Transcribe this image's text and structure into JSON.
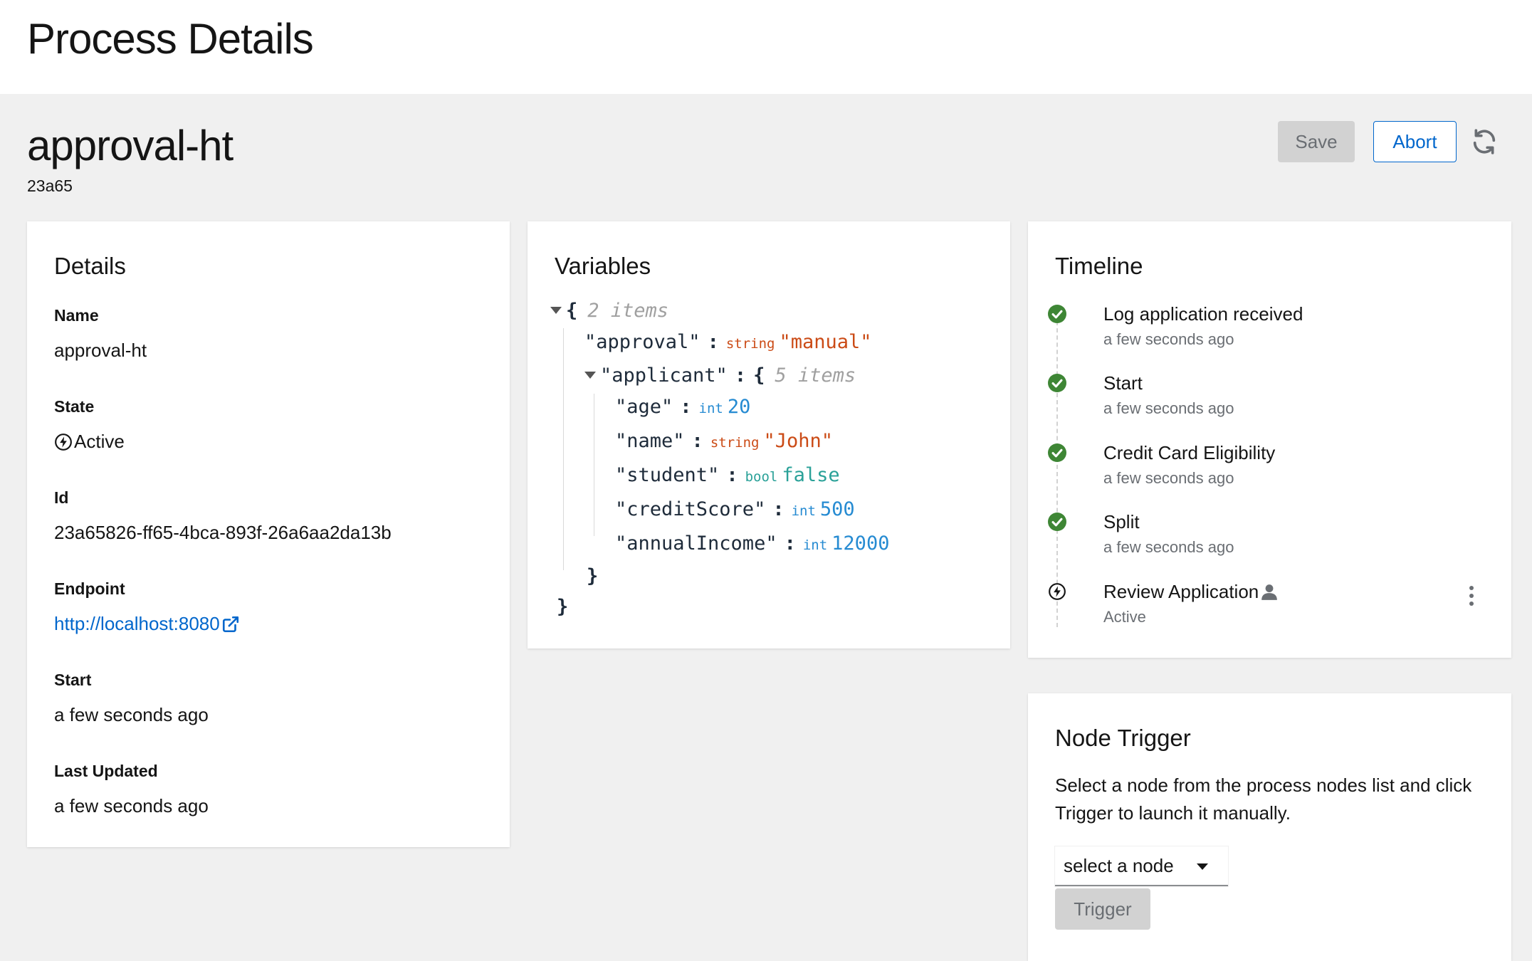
{
  "header": {
    "title": "Process Details"
  },
  "process": {
    "name": "approval-ht",
    "short_id": "23a65"
  },
  "actions": {
    "save_label": "Save",
    "abort_label": "Abort",
    "refresh_icon": "sync-icon"
  },
  "details": {
    "title": "Details",
    "fields": {
      "name": {
        "label": "Name",
        "value": "approval-ht"
      },
      "state": {
        "label": "State",
        "value": "Active",
        "icon": "bolt-circle-icon"
      },
      "id": {
        "label": "Id",
        "value": "23a65826-ff65-4bca-893f-26a6aa2da13b"
      },
      "endpoint": {
        "label": "Endpoint",
        "value": "http://localhost:8080",
        "icon": "external-link-icon"
      },
      "start": {
        "label": "Start",
        "value": "a few seconds ago"
      },
      "last_updated": {
        "label": "Last Updated",
        "value": "a few seconds ago"
      }
    }
  },
  "variables": {
    "title": "Variables",
    "root_meta": "2 items",
    "approval": {
      "key": "\"approval\"",
      "type": "string",
      "value": "\"manual\""
    },
    "applicant": {
      "key": "\"applicant\"",
      "meta": "5 items",
      "items": [
        {
          "key": "\"age\"",
          "type": "int",
          "value": "20"
        },
        {
          "key": "\"name\"",
          "type": "string",
          "value": "\"John\""
        },
        {
          "key": "\"student\"",
          "type": "bool",
          "value": "false"
        },
        {
          "key": "\"creditScore\"",
          "type": "int",
          "value": "500"
        },
        {
          "key": "\"annualIncome\"",
          "type": "int",
          "value": "12000"
        }
      ]
    },
    "open_brace": "{",
    "close_brace": "}",
    "colon": ":"
  },
  "timeline": {
    "title": "Timeline",
    "items": [
      {
        "title": "Log application received",
        "time": "a few seconds ago",
        "status": "completed"
      },
      {
        "title": "Start",
        "time": "a few seconds ago",
        "status": "completed"
      },
      {
        "title": "Credit Card Eligibility",
        "time": "a few seconds ago",
        "status": "completed"
      },
      {
        "title": "Split",
        "time": "a few seconds ago",
        "status": "completed"
      },
      {
        "title": "Review Application",
        "time": "Active",
        "status": "active",
        "extra_icon": "user-icon"
      }
    ]
  },
  "node_trigger": {
    "title": "Node Trigger",
    "description": "Select a node from the process nodes list and click Trigger to launch it manually.",
    "select_value": "select a node",
    "trigger_label": "Trigger"
  },
  "colors": {
    "accent": "#0066cc",
    "success": "#3e8635",
    "string_type": "#cb4b16",
    "int_type": "#268bd2",
    "bool_type": "#2aa198"
  }
}
